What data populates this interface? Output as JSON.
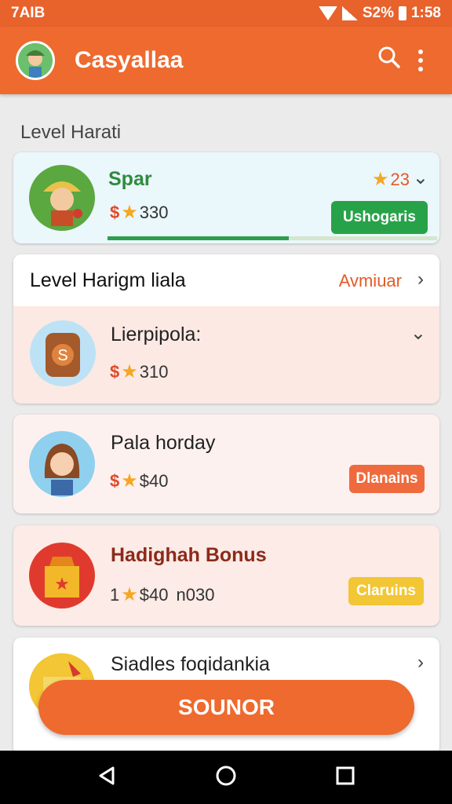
{
  "status_bar": {
    "left_text": "7AIB",
    "battery_text": "S2%",
    "time": "1:58"
  },
  "app_bar": {
    "title": "Casyallaa",
    "search_icon": "search-icon",
    "menu_icon": "more-vert-icon"
  },
  "section_title": "Level Harati",
  "cards": [
    {
      "name": "Spar",
      "price_prefix": "$",
      "price": "330",
      "rating": "23",
      "action_label": "Ushogaris",
      "progress": 0.55,
      "name_color": "#2e8b3e",
      "action_color": "#27a248"
    },
    {
      "header_title": "Level Harigm liala",
      "header_link": "Avmiuar",
      "name": "Lierpipola:",
      "price_prefix": "$",
      "price": "310",
      "avatar_icon": "backpack-icon"
    },
    {
      "name": "Pala horday",
      "price_prefix": "$",
      "price": "$40",
      "action_label": "Dlanains",
      "action_color": "#ef6a3c",
      "avatar_icon": "woman-avatar"
    },
    {
      "name": "Hadighah Bonus",
      "price_prefix": "1",
      "price": "$40",
      "price_suffix": "n030",
      "action_label": "Claruins",
      "action_color": "#f2c634",
      "name_color": "#8b2a1a",
      "avatar_icon": "gift-box-icon"
    },
    {
      "name": "Siadles foqidankia",
      "avatar_icon": "gift-icon"
    }
  ],
  "fab_label": "SOUNOR",
  "nav": {
    "back": "back-icon",
    "home": "home-icon",
    "recents": "recents-icon"
  }
}
